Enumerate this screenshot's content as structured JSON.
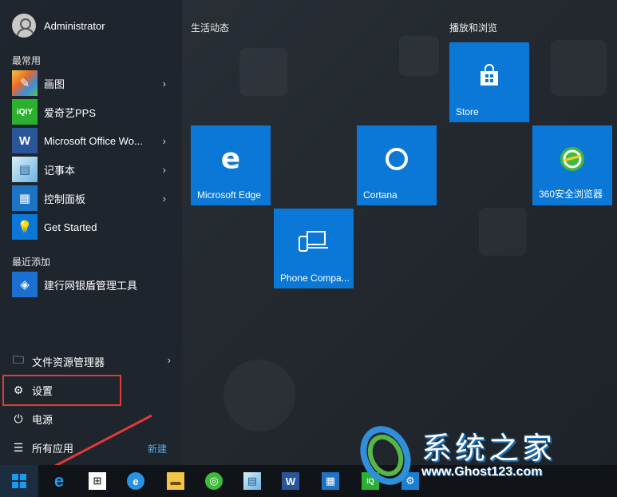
{
  "user": {
    "name": "Administrator"
  },
  "sections": {
    "most_used": "最常用",
    "recently_added": "最近添加"
  },
  "apps": [
    {
      "label": "画图",
      "icon": "paint-icon",
      "has_chevron": true
    },
    {
      "label": "爱奇艺PPS",
      "icon": "iqiyi-icon",
      "has_chevron": false
    },
    {
      "label": "Microsoft Office Wo...",
      "icon": "word-icon",
      "has_chevron": true
    },
    {
      "label": "记事本",
      "icon": "notepad-icon",
      "has_chevron": true
    },
    {
      "label": "控制面板",
      "icon": "control-panel-icon",
      "has_chevron": true
    },
    {
      "label": "Get Started",
      "icon": "get-started-icon",
      "has_chevron": false
    }
  ],
  "recent": [
    {
      "label": "建行网银盾管理工具",
      "icon": "ccb-icon"
    }
  ],
  "system": {
    "file_explorer": "文件资源管理器",
    "settings": "设置",
    "power": "电源",
    "all_apps": "所有应用",
    "new_badge": "新建"
  },
  "groups": {
    "left_title": "生活动态",
    "right_title": "播放和浏览"
  },
  "tiles": [
    {
      "label": "Store",
      "icon": "store-icon"
    },
    {
      "label": "Microsoft Edge",
      "icon": "edge-icon"
    },
    {
      "label": "Cortana",
      "icon": "cortana-icon"
    },
    {
      "label": "360安全浏览器",
      "icon": "360-browser-icon"
    },
    {
      "label": "Phone Compa...",
      "icon": "phone-companion-icon"
    }
  ],
  "taskbar": [
    "windows-start-icon",
    "edge-icon",
    "store-icon",
    "ie-icon",
    "file-explorer-icon",
    "360-browser-icon",
    "notepad-icon",
    "word-icon",
    "control-panel-icon",
    "iqiyi-icon",
    "settings-icon"
  ],
  "watermark": {
    "text": "系统之家",
    "url": "www.Ghost123.com"
  },
  "colors": {
    "tile_blue": "#0b78d7",
    "highlight_red": "#e03a3a",
    "accent": "#5aa9e6"
  }
}
